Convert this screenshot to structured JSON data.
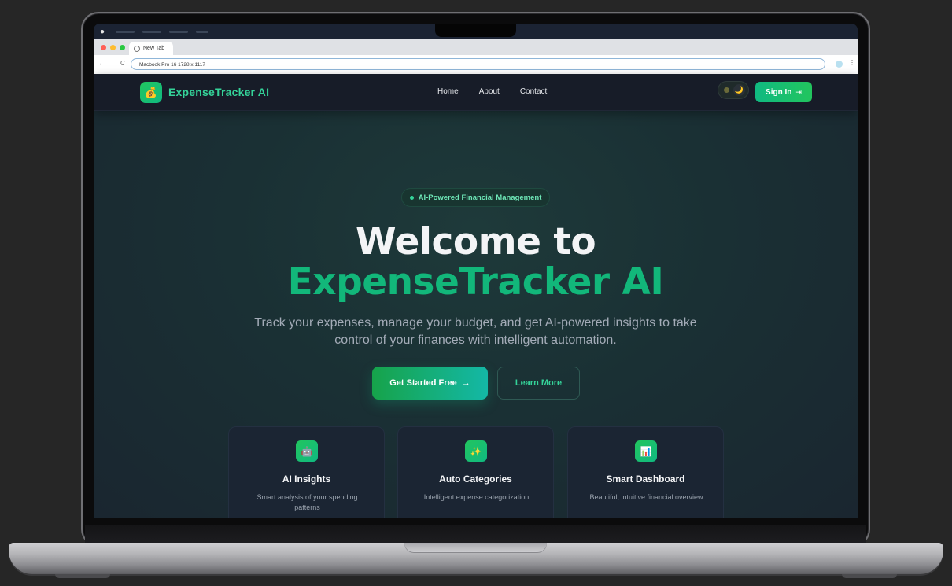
{
  "browser": {
    "tab_title": "New Tab",
    "address": "Macbook Pro 16  1728 x 1117",
    "back_glyph": "←",
    "forward_glyph": "→",
    "reload_glyph": "C",
    "menu_glyph": "⋮"
  },
  "nav": {
    "logo_icon": "💰",
    "brand": "ExpenseTracker AI",
    "links": [
      "Home",
      "About",
      "Contact"
    ],
    "theme_icon": "🌙",
    "signin_label": "Sign In",
    "signin_icon": "⇥"
  },
  "hero": {
    "badge": "AI-Powered Financial Management",
    "title_line1": "Welcome to",
    "title_line2": "ExpenseTracker AI",
    "subtitle": "Track your expenses, manage your budget, and get AI-powered insights to take control of your finances with intelligent automation.",
    "primary_cta": "Get Started Free",
    "primary_arrow": "→",
    "secondary_cta": "Learn More"
  },
  "features": [
    {
      "icon": "🤖",
      "icon_name": "robot-icon",
      "title": "AI Insights",
      "description": "Smart analysis of your spending patterns"
    },
    {
      "icon": "✨",
      "icon_name": "sparkles-icon",
      "title": "Auto Categories",
      "description": "Intelligent expense categorization"
    },
    {
      "icon": "📊",
      "icon_name": "chart-icon",
      "title": "Smart Dashboard",
      "description": "Beautiful, intuitive financial overview"
    }
  ],
  "colors": {
    "accent": "#10b981",
    "brand_green": "#34d399",
    "nav_bg": "#171c28"
  }
}
